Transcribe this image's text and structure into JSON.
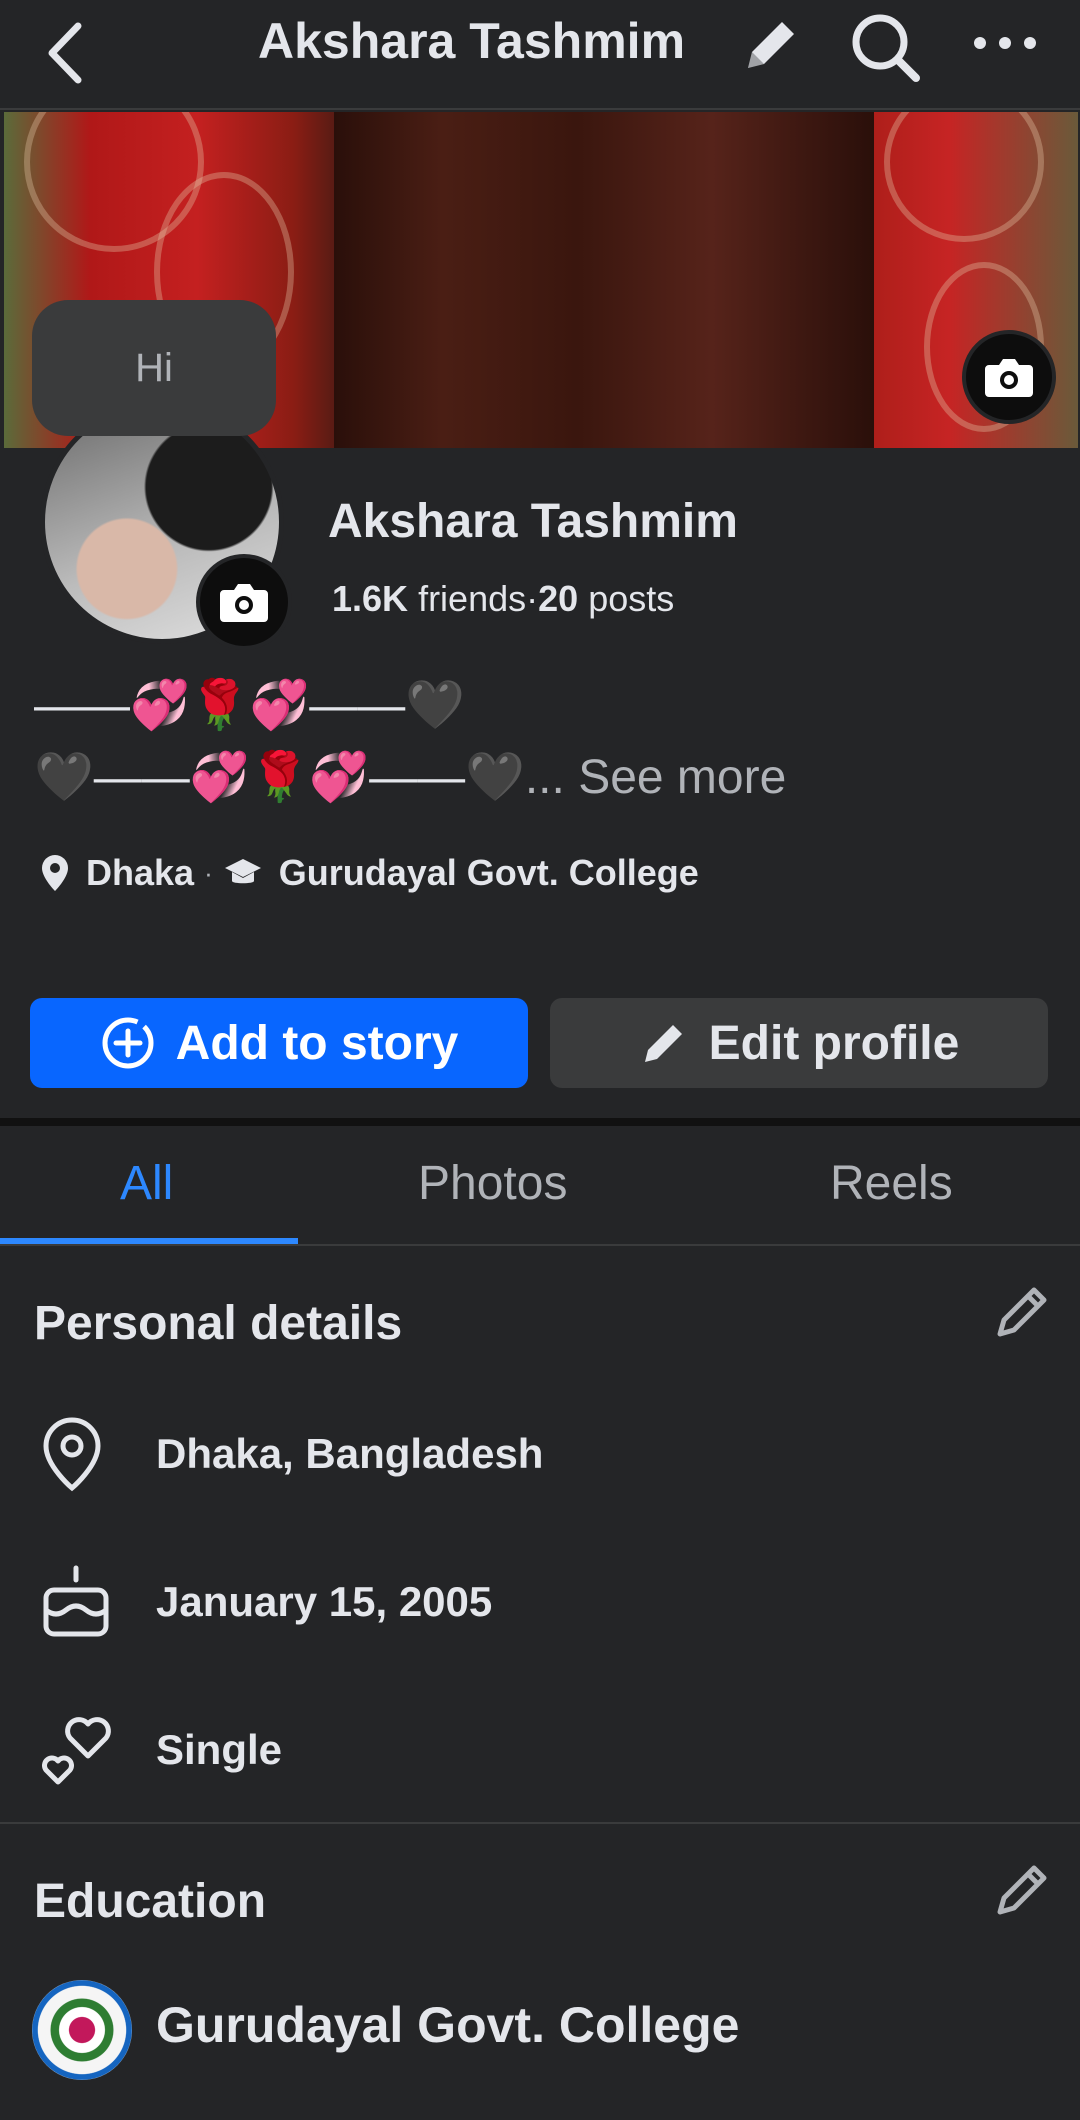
{
  "header": {
    "title": "Akshara Tashmim"
  },
  "hi_bubble": {
    "text": "Hi"
  },
  "profile": {
    "name": "Akshara Tashmim",
    "friends_count": "1.6K",
    "friends_label": "friends",
    "separator": "·",
    "posts_count": "20",
    "posts_label": "posts"
  },
  "bio": {
    "line1": "——💞🌹💞——🖤",
    "line2": "🖤——💞🌹💞——🖤",
    "ellipsis": "...",
    "see_more": "See more"
  },
  "meta": {
    "location": "Dhaka",
    "separator": "·",
    "education": "Gurudayal Govt. College"
  },
  "actions": {
    "add_story": "Add to story",
    "edit_profile": "Edit profile"
  },
  "tabs": [
    {
      "label": "All",
      "active": true
    },
    {
      "label": "Photos",
      "active": false
    },
    {
      "label": "Reels",
      "active": false
    }
  ],
  "personal_details": {
    "title": "Personal details",
    "location": "Dhaka, Bangladesh",
    "birthday": "January 15, 2005",
    "relationship": "Single"
  },
  "education": {
    "title": "Education",
    "school": "Gurudayal Govt. College"
  },
  "colors": {
    "background": "#242527",
    "primary_blue": "#0866ff",
    "tab_active": "#2d88ff",
    "secondary_button": "#3a3b3c",
    "text": "#e4e6eb",
    "muted_text": "#b0b3b8"
  },
  "icons": [
    "back-arrow-icon",
    "pencil-icon",
    "search-icon",
    "more-icon",
    "camera-icon",
    "location-pin-icon",
    "graduation-cap-icon",
    "add-circle-icon",
    "birthday-cake-icon",
    "hearts-icon"
  ]
}
